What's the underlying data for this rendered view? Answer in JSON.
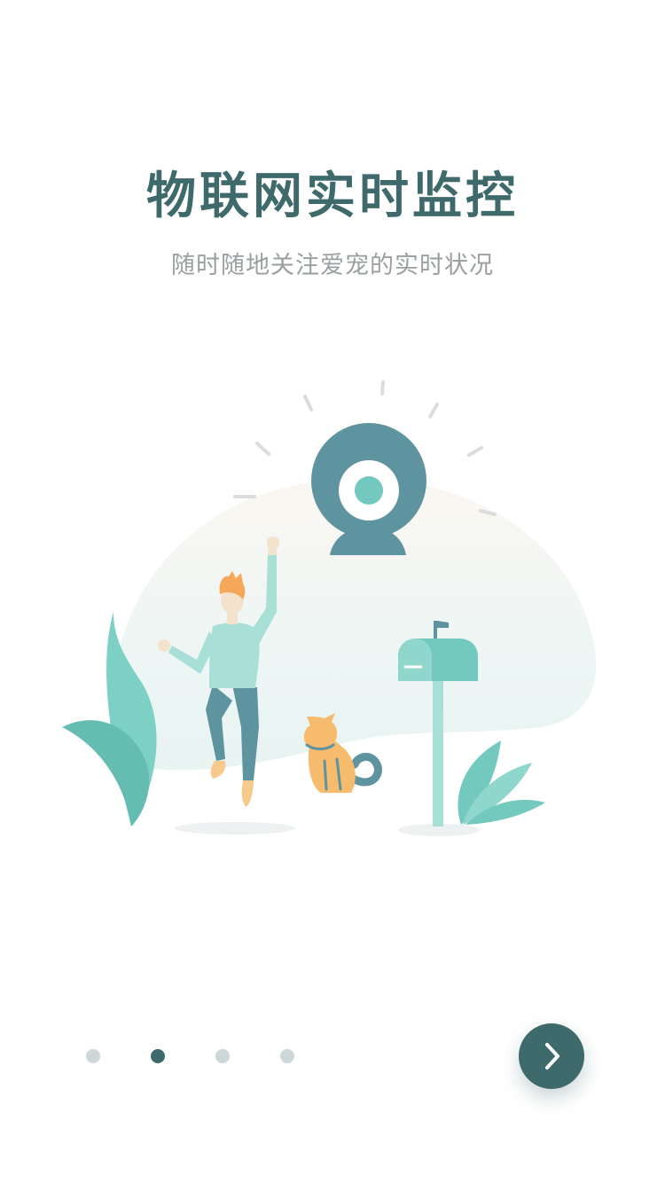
{
  "onboarding": {
    "title": "物联网实时监控",
    "subtitle": "随时随地关注爱宠的实时状况"
  },
  "pager": {
    "total": 4,
    "active_index": 1
  },
  "icons": {
    "next": "chevron-right-icon"
  },
  "colors": {
    "primary": "#3f6a6b",
    "title": "#3f6a6b",
    "subtitle": "#9a9fa1",
    "dot_inactive": "#cdd6d8",
    "teal": "#74c9bf",
    "camera": "#5e93a0",
    "cat": "#f6bb6c"
  }
}
